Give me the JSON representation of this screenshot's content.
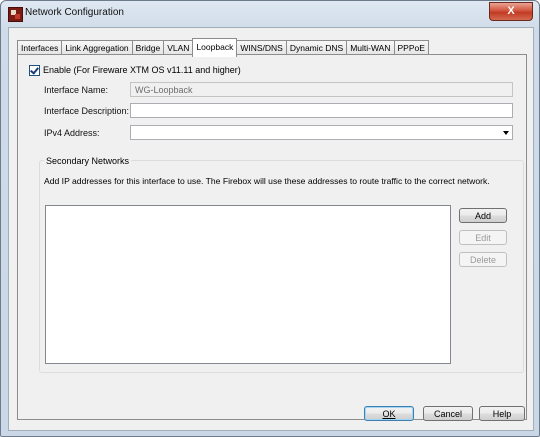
{
  "window": {
    "title": "Network Configuration",
    "close_label": "X"
  },
  "tabs": [
    {
      "label": "Interfaces",
      "active": false
    },
    {
      "label": "Link Aggregation",
      "active": false
    },
    {
      "label": "Bridge",
      "active": false
    },
    {
      "label": "VLAN",
      "active": false
    },
    {
      "label": "Loopback",
      "active": true
    },
    {
      "label": "WINS/DNS",
      "active": false
    },
    {
      "label": "Dynamic DNS",
      "active": false
    },
    {
      "label": "Multi-WAN",
      "active": false
    },
    {
      "label": "PPPoE",
      "active": false
    }
  ],
  "loopback": {
    "enable_checked": true,
    "enable_label": "Enable (For Fireware XTM OS v11.11 and higher)",
    "interface_name_label": "Interface Name:",
    "interface_name_value": "WG-Loopback",
    "interface_description_label": "Interface Description:",
    "interface_description_value": "",
    "ipv4_label": "IPv4 Address:",
    "ipv4_value": ""
  },
  "secondary": {
    "title": "Secondary Networks",
    "description": "Add IP addresses for this interface to use. The Firebox will use these addresses to route traffic to the correct network.",
    "items": [],
    "add_label": "Add",
    "edit_label": "Edit",
    "delete_label": "Delete"
  },
  "footer": {
    "ok_label": "OK",
    "cancel_label": "Cancel",
    "help_label": "Help"
  }
}
